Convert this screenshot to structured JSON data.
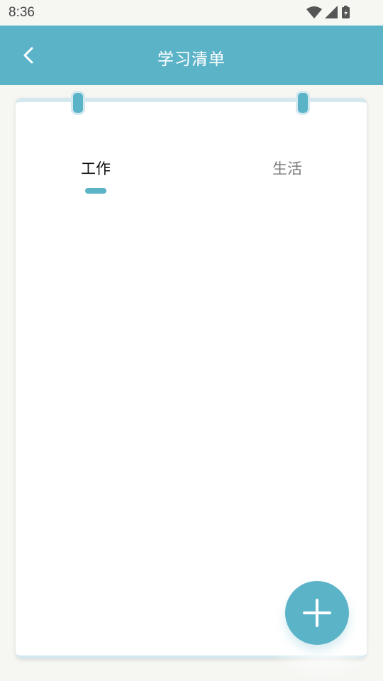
{
  "status": {
    "time": "8:36",
    "icons": [
      "wifi-icon",
      "signal-icon",
      "battery-charging-icon"
    ]
  },
  "header": {
    "title": "学习清单",
    "back_icon": "chevron-left-icon"
  },
  "tabs": [
    {
      "label": "工作",
      "selected": true
    },
    {
      "label": "生活",
      "selected": false
    }
  ],
  "fab": {
    "icon": "plus-icon"
  },
  "colors": {
    "accent": "#5bb3c8",
    "background": "#f6f6f3",
    "card": "#ffffff",
    "ring_border": "#d4e9ef"
  }
}
